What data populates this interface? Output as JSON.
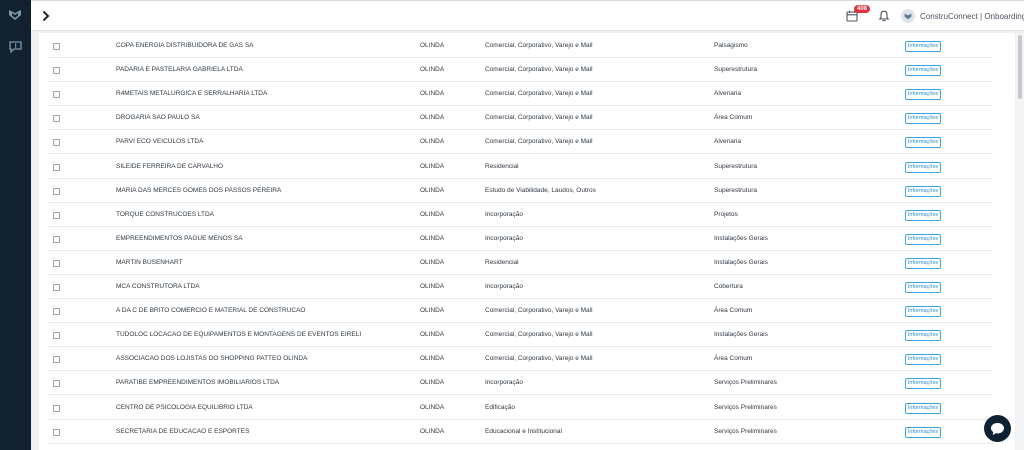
{
  "header": {
    "calendar_badge": "408",
    "user_label": "ConstruConnect | Onboarding",
    "caret": "⌄"
  },
  "icons": {
    "sidebar_logo": "shield-logo-icon",
    "sidebar_item": "comment-alert-icon",
    "toggle": "chevron-right-icon",
    "calendar": "calendar-icon",
    "bell": "bell-icon",
    "chat": "chat-bubble-icon"
  },
  "colors": {
    "sidebar": "#11212f",
    "accent": "#2a8fd0",
    "badge": "#e0343a"
  },
  "table": {
    "button_label": "Informações",
    "rows": [
      {
        "name": "COPA ENERGIA DISTRIBUIDORA DE GAS SA",
        "city": "OLINDA",
        "segment": "Comercial, Corporativo, Varejo e Mall",
        "stage": "Paisagismo"
      },
      {
        "name": "PADARIA E PASTELARIA GABRIELA LTDA",
        "city": "OLINDA",
        "segment": "Comercial, Corporativo, Varejo e Mall",
        "stage": "Superestrutura"
      },
      {
        "name": "R4METAIS METALURGICA E SERRALHARIA LTDA",
        "city": "OLINDA",
        "segment": "Comercial, Corporativo, Varejo e Mall",
        "stage": "Alvenaria"
      },
      {
        "name": "DROGARIA SAO PAULO SA",
        "city": "OLINDA",
        "segment": "Comercial, Corporativo, Varejo e Mall",
        "stage": "Área Comum"
      },
      {
        "name": "PARVI ECO VEICULOS LTDA",
        "city": "OLINDA",
        "segment": "Comercial, Corporativo, Varejo e Mall",
        "stage": "Alvenaria"
      },
      {
        "name": "SILEIDE FERREIRA DE CARVALHO",
        "city": "OLINDA",
        "segment": "Residencial",
        "stage": "Superestrutura"
      },
      {
        "name": "MARIA DAS MERCES GOMES DOS PASSOS PEREIRA",
        "city": "OLINDA",
        "segment": "Estudo de Viabilidade, Laudos, Outros",
        "stage": "Superestrutura"
      },
      {
        "name": "TORQUE CONSTRUCOES LTDA",
        "city": "OLINDA",
        "segment": "Incorporação",
        "stage": "Projetos"
      },
      {
        "name": "EMPREENDIMENTOS PAGUE MENOS SA",
        "city": "OLINDA",
        "segment": "Incorporação",
        "stage": "Instalações Gerais"
      },
      {
        "name": "MARTIN BUSENHART",
        "city": "OLINDA",
        "segment": "Residencial",
        "stage": "Instalações Gerais"
      },
      {
        "name": "MCA CONSTRUTORA LTDA",
        "city": "OLINDA",
        "segment": "Incorporação",
        "stage": "Cobertura"
      },
      {
        "name": "A DA C DE BRITO COMERCIO E MATERIAL DE CONSTRUCAO",
        "city": "OLINDA",
        "segment": "Comercial, Corporativo, Varejo e Mall",
        "stage": "Área Comum"
      },
      {
        "name": "TUDOLOC LOCACAO DE EQUIPAMENTOS E MONTAGENS DE EVENTOS EIRELI",
        "city": "OLINDA",
        "segment": "Comercial, Corporativo, Varejo e Mall",
        "stage": "Instalações Gerais"
      },
      {
        "name": "ASSOCIACAO DOS LOJISTAS DO SHOPPING PATTEO OLINDA",
        "city": "OLINDA",
        "segment": "Comercial, Corporativo, Varejo e Mall",
        "stage": "Área Comum"
      },
      {
        "name": "PARATIBE EMPREENDIMENTOS IMOBILIARIOS LTDA",
        "city": "OLINDA",
        "segment": "Incorporação",
        "stage": "Serviços Preliminares"
      },
      {
        "name": "CENTRO DE PSICOLOGIA EQUILIBRIO LTDA",
        "city": "OLINDA",
        "segment": "Edificação",
        "stage": "Serviços Preliminares"
      },
      {
        "name": "SECRETARIA DE EDUCACAO E ESPORTES",
        "city": "OLINDA",
        "segment": "Educacional e Institucional",
        "stage": "Serviços Preliminares"
      }
    ]
  }
}
